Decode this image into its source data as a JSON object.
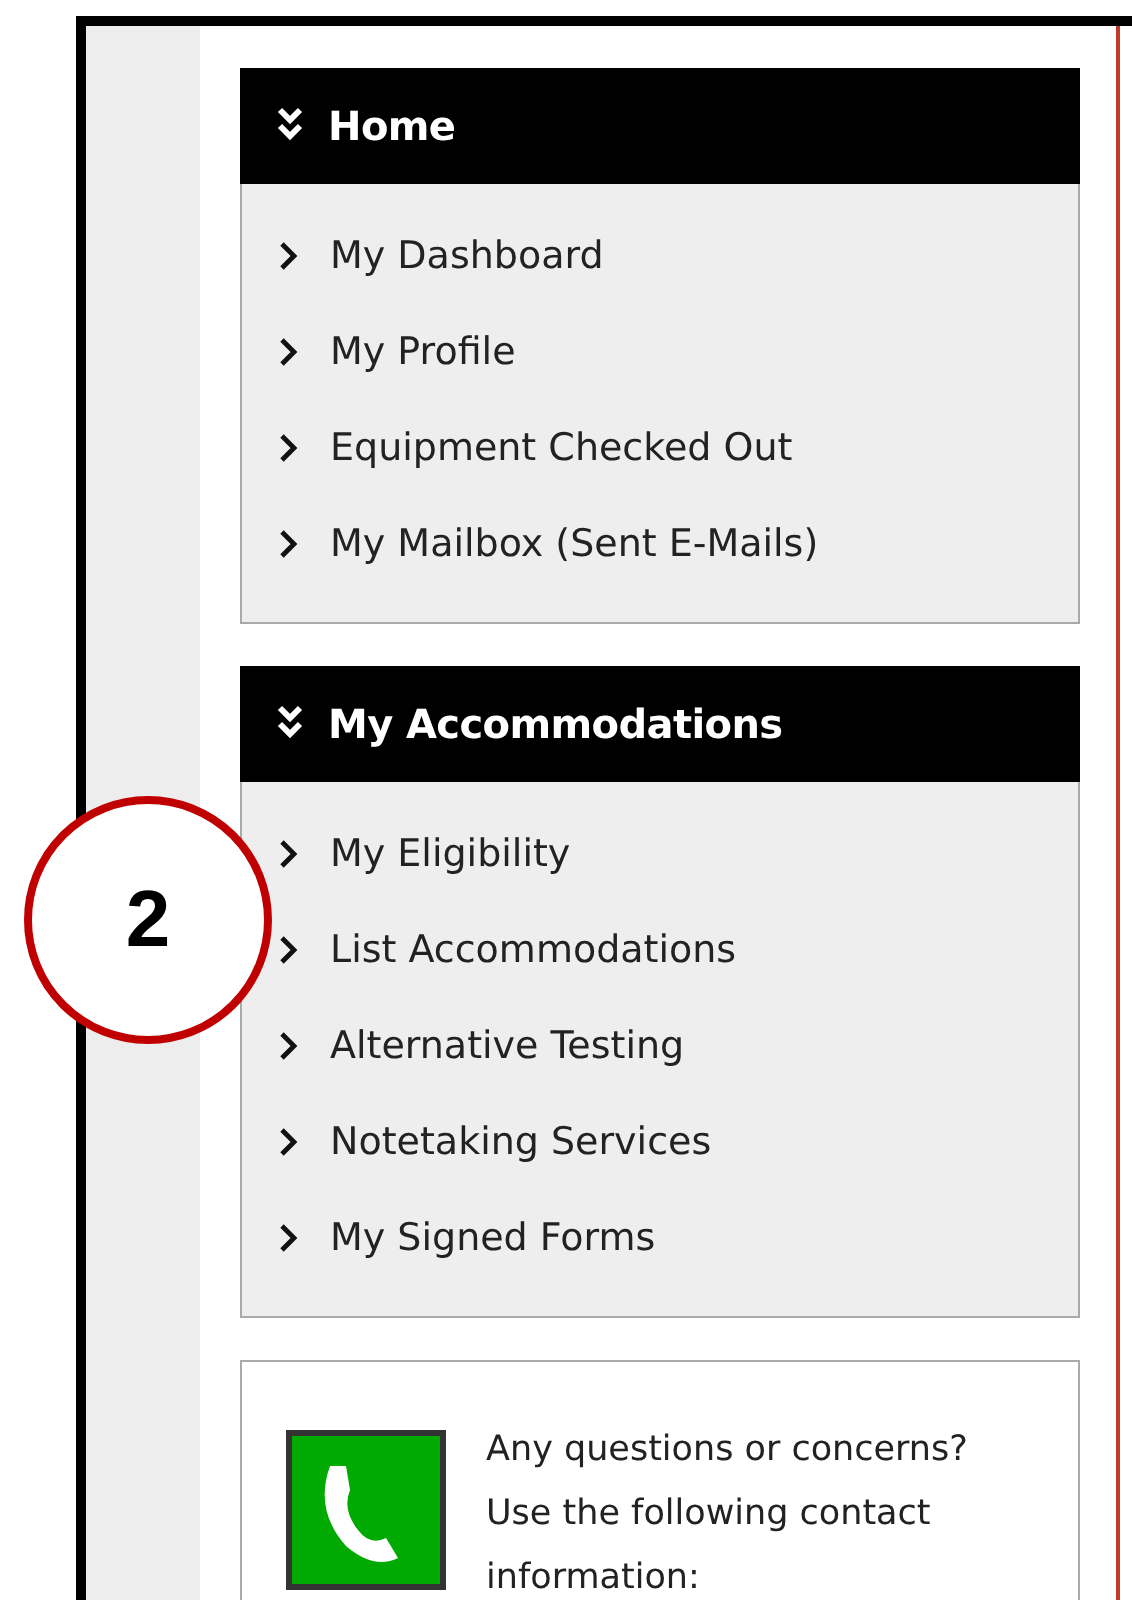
{
  "sections": [
    {
      "title": "Home",
      "items": [
        "My Dashboard",
        "My Profile",
        "Equipment Checked Out",
        "My Mailbox (Sent E-Mails)"
      ]
    },
    {
      "title": "My Accommodations",
      "items": [
        "My Eligibility",
        "List Accommodations",
        "Alternative Testing",
        "Notetaking Services",
        "My Signed Forms"
      ]
    }
  ],
  "contact": {
    "lines": [
      "Any questions or concerns?",
      "Use the following contact",
      "information:"
    ]
  },
  "callout": {
    "number": "2"
  }
}
